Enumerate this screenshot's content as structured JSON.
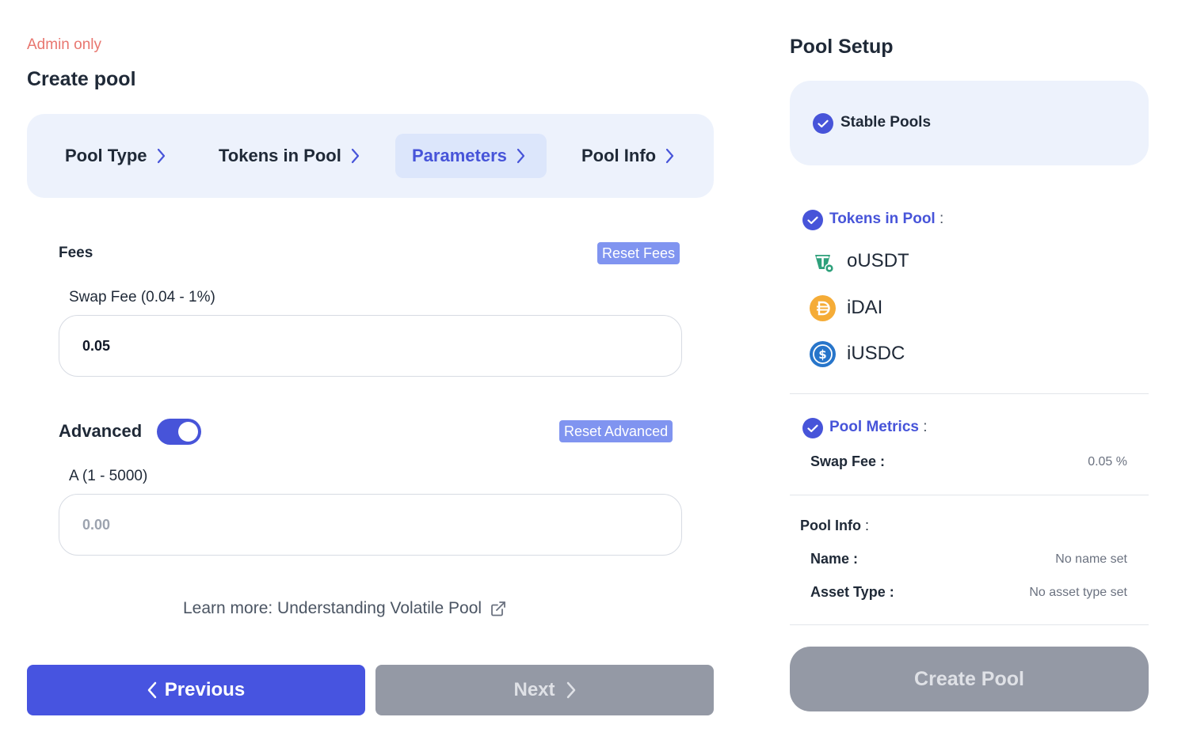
{
  "header": {
    "admin_note": "Admin only",
    "title": "Create pool"
  },
  "stepper": {
    "steps": [
      {
        "label": "Pool Type",
        "active": false
      },
      {
        "label": "Tokens in Pool",
        "active": false
      },
      {
        "label": "Parameters",
        "active": true
      },
      {
        "label": "Pool Info",
        "active": false
      }
    ]
  },
  "fees": {
    "section_label": "Fees",
    "reset_label": "Reset Fees",
    "swap_fee_label": "Swap Fee (0.04 - 1%)",
    "swap_fee_value": "0.05"
  },
  "advanced": {
    "section_label": "Advanced",
    "toggle_on": true,
    "reset_label": "Reset Advanced",
    "a_label": "A (1 - 5000)",
    "a_placeholder": "0.00",
    "a_value": ""
  },
  "learn_more": "Learn more: Understanding Volatile Pool",
  "nav": {
    "previous_label": "Previous",
    "next_label": "Next"
  },
  "sidebar": {
    "title": "Pool Setup",
    "pool_type": "Stable Pools",
    "tokens_header": "Tokens in Pool",
    "tokens": [
      {
        "name": "oUSDT",
        "icon": "usdt-token-icon",
        "color": "#2ea07b"
      },
      {
        "name": "iDAI",
        "icon": "dai-token-icon",
        "color": "#f5ac37"
      },
      {
        "name": "iUSDC",
        "icon": "usdc-token-icon",
        "color": "#2775ca"
      }
    ],
    "metrics_header": "Pool Metrics",
    "metrics": [
      {
        "key": "Swap Fee :",
        "value": "0.05 %"
      }
    ],
    "pool_info_header": "Pool Info",
    "pool_info": [
      {
        "key": "Name :",
        "value": "No name set"
      },
      {
        "key": "Asset Type :",
        "value": "No asset type set"
      }
    ],
    "colon": ":",
    "create_label": "Create Pool"
  },
  "colors": {
    "accent": "#4754d9",
    "admin": "#e8766f",
    "panel_bg": "#edf2fc",
    "disabled": "#9499a5",
    "badge": "#8094f0"
  }
}
